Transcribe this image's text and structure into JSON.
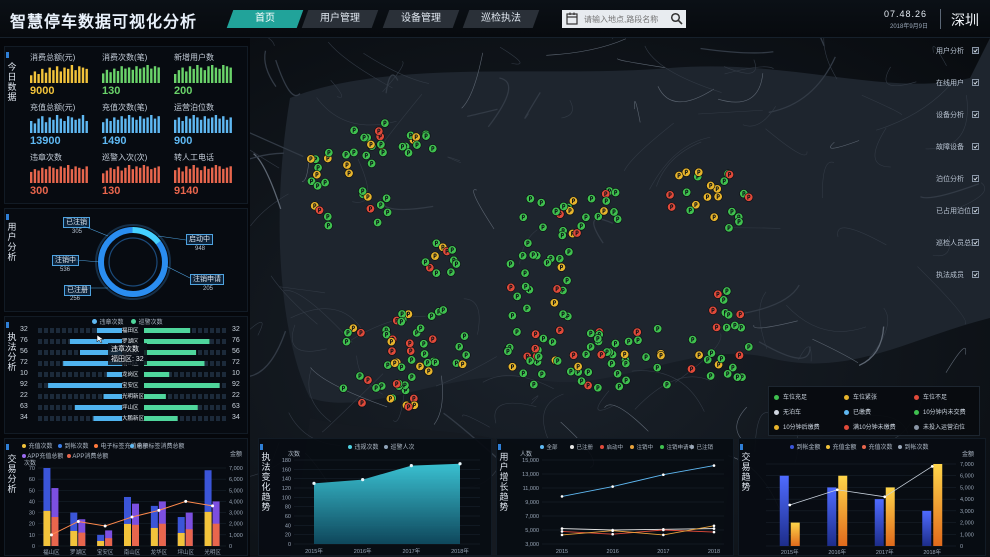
{
  "header": {
    "title": "智慧停车数据可视化分析",
    "nav": [
      "首页",
      "用户管理",
      "设备管理",
      "巡检执法"
    ],
    "search_placeholder": "请输入地点,路段名称",
    "time": "07.48.26",
    "date": "2018年9月9日",
    "city": "深圳"
  },
  "today": {
    "side": "今日数据",
    "metrics": [
      {
        "label": "消费总额(元)",
        "value": "9000",
        "color": "#f2c33b",
        "spark": [
          6,
          9,
          7,
          11,
          8,
          12,
          10,
          13,
          9,
          12,
          11,
          14,
          10,
          13,
          12,
          11
        ]
      },
      {
        "label": "消费次数(笔)",
        "value": "130",
        "color": "#6ad36a",
        "spark": [
          8,
          11,
          9,
          12,
          10,
          14,
          12,
          13,
          11,
          14,
          12,
          13,
          15,
          12,
          14,
          13
        ]
      },
      {
        "label": "新增用户数",
        "value": "200",
        "color": "#6ad36a",
        "spark": [
          7,
          10,
          12,
          9,
          13,
          11,
          14,
          12,
          10,
          13,
          14,
          12,
          11,
          14,
          13,
          12
        ]
      },
      {
        "label": "充值总额(元)",
        "value": "13900",
        "color": "#5fb8f2",
        "spark": [
          10,
          8,
          12,
          14,
          9,
          13,
          11,
          15,
          12,
          10,
          14,
          13,
          11,
          12,
          15,
          10
        ]
      },
      {
        "label": "充值次数(笔)",
        "value": "1490",
        "color": "#5fb8f2",
        "spark": [
          9,
          12,
          10,
          13,
          11,
          14,
          12,
          15,
          13,
          11,
          14,
          12,
          13,
          15,
          12,
          14
        ]
      },
      {
        "label": "运营泊位数",
        "value": "900",
        "color": "#5fb8f2",
        "spark": [
          11,
          13,
          10,
          14,
          12,
          15,
          13,
          11,
          14,
          12,
          13,
          15,
          12,
          14,
          11,
          13
        ]
      },
      {
        "label": "违章次数",
        "value": "300",
        "color": "#e8664d",
        "spark": [
          8,
          10,
          9,
          11,
          10,
          12,
          11,
          10,
          12,
          11,
          13,
          10,
          12,
          11,
          10,
          12
        ]
      },
      {
        "label": "巡警入次(次)",
        "value": "130",
        "color": "#e8664d",
        "spark": [
          7,
          9,
          11,
          10,
          12,
          9,
          11,
          13,
          10,
          12,
          11,
          13,
          12,
          10,
          11,
          12
        ]
      },
      {
        "label": "转人工电话",
        "value": "9140",
        "color": "#e8664d",
        "spark": [
          10,
          12,
          9,
          13,
          11,
          14,
          12,
          10,
          13,
          11,
          12,
          14,
          13,
          11,
          12,
          13
        ]
      }
    ]
  },
  "users": {
    "side": "用户分析",
    "items": [
      {
        "label": "已注销",
        "value": "305"
      },
      {
        "label": "注销中",
        "value": "536"
      },
      {
        "label": "已注册",
        "value": "256"
      },
      {
        "label": "启动中",
        "value": "948"
      },
      {
        "label": "注销申请",
        "value": "205"
      }
    ]
  },
  "enforce": {
    "side": "执法分析",
    "legend": [
      "违章次数",
      "巡警次数"
    ],
    "rows": [
      {
        "left": "32",
        "name": "福田区",
        "right": "32",
        "a": 0.3,
        "b": 0.55
      },
      {
        "left": "76",
        "name": "罗湖区",
        "right": "76",
        "a": 0.62,
        "b": 0.78
      },
      {
        "left": "56",
        "name": "盐田区",
        "right": "56",
        "a": 0.5,
        "b": 0.62
      },
      {
        "left": "72",
        "name": "南山区",
        "right": "72",
        "a": 0.7,
        "b": 0.72
      },
      {
        "left": "10",
        "name": "龙岗区",
        "right": "10",
        "a": 0.18,
        "b": 0.3
      },
      {
        "left": "92",
        "name": "宝安区",
        "right": "92",
        "a": 0.88,
        "b": 0.9
      },
      {
        "left": "22",
        "name": "光明新区",
        "right": "22",
        "a": 0.22,
        "b": 0.26
      },
      {
        "left": "63",
        "name": "坪山区",
        "right": "63",
        "a": 0.56,
        "b": 0.64
      },
      {
        "left": "34",
        "name": "大鹏新区",
        "right": "34",
        "a": 0.34,
        "b": 0.4
      }
    ],
    "tooltip": {
      "line1": "违章次数",
      "line2": "福田区: 32"
    }
  },
  "right_menu": [
    "用户分析",
    "在线用户",
    "设备分析",
    "故障设备",
    "泊位分析",
    "已占用泊位",
    "巡检人员总数",
    "执法成员"
  ],
  "map_legend": [
    {
      "label": "车位充足",
      "color": "#3fc04f"
    },
    {
      "label": "车位紧张",
      "color": "#e7b42c"
    },
    {
      "label": "车位不足",
      "color": "#e04a3a"
    },
    {
      "label": "无泊车",
      "color": "#cfd6df"
    },
    {
      "label": "已缴费",
      "color": "#5fb8f2"
    },
    {
      "label": "10分钟内未交费",
      "color": "#3fc04f"
    },
    {
      "label": "10分钟后缴费",
      "color": "#e7b42c"
    },
    {
      "label": "满10分钟未缴费",
      "color": "#e04a3a"
    },
    {
      "label": "未投入运营泊位",
      "color": "#8a96a6"
    }
  ],
  "charts": {
    "trade": {
      "side": "交易分析",
      "legend": [
        "充值次数",
        "到帐次数",
        "电子标签充值总额",
        "电子标签消费总额",
        "APP充值总额",
        "APP消费总额"
      ],
      "ylabel_left": "次数",
      "ylabel_right": "金额"
    },
    "trend": {
      "side": "执法变化趋势",
      "legend": [
        "违规次数",
        "巡警人次"
      ],
      "ylabel": "次数"
    },
    "growth": {
      "side": "用户增长趋势",
      "legend": [
        "全部",
        "已注册",
        "启动中",
        "注销中",
        "注销申请中",
        "已注销"
      ],
      "ylabel": "人数"
    },
    "trade2": {
      "side": "交易趋势",
      "legend": [
        "到帐金额",
        "充值金额",
        "充值次数",
        "到帐次数"
      ],
      "ylabel": "金额"
    }
  },
  "chart_data": [
    {
      "type": "bar",
      "categories": [
        "福山区",
        "罗湖区",
        "宝安区",
        "南山区",
        "龙华区",
        "坪山区",
        "光明区"
      ],
      "series": [
        {
          "name": "充值次数",
          "values": [
            70,
            30,
            10,
            44,
            36,
            26,
            68
          ]
        },
        {
          "name": "到帐次数",
          "values": [
            52,
            24,
            14,
            38,
            40,
            30,
            40
          ]
        }
      ],
      "line": [
        10,
        22,
        18,
        26,
        32,
        40,
        36
      ],
      "ylim": [
        0,
        70
      ],
      "yticks_left": [
        "0",
        "10",
        "20",
        "30",
        "40",
        "50",
        "60",
        "70"
      ],
      "yticks_right": [
        "0",
        "1,000",
        "2,000",
        "3,000",
        "4,000",
        "5,000",
        "6,000",
        "7,000"
      ]
    },
    {
      "type": "area",
      "categories": [
        "2015年",
        "2016年",
        "2017年",
        "2018年"
      ],
      "series": [
        {
          "name": "违规次数",
          "values": [
            130,
            138,
            168,
            172
          ]
        }
      ],
      "ylim": [
        0,
        180
      ],
      "yticks": [
        "0",
        "20",
        "40",
        "60",
        "80",
        "100",
        "120",
        "140",
        "160",
        "180"
      ]
    },
    {
      "type": "line",
      "categories": [
        "2015",
        "2016",
        "2017",
        "2018"
      ],
      "series": [
        {
          "name": "全部",
          "values": [
            9800,
            11200,
            12900,
            14200
          ]
        },
        {
          "name": "已注册",
          "values": [
            5200,
            5000,
            5100,
            5200
          ]
        },
        {
          "name": "启动中",
          "values": [
            4800,
            4400,
            5000,
            4700
          ]
        },
        {
          "name": "注销中",
          "values": [
            4300,
            4900,
            4300,
            5600
          ]
        }
      ],
      "ylim": [
        3000,
        15000
      ],
      "yticks": [
        "3,000",
        "5,000",
        "7,000",
        "9,000",
        "11,000",
        "13,000",
        "15,000"
      ]
    },
    {
      "type": "bar",
      "categories": [
        "2015年",
        "2016年",
        "2017年",
        "2018年"
      ],
      "series": [
        {
          "name": "到帐金额",
          "values": [
            6000,
            5000,
            4000,
            3000
          ]
        },
        {
          "name": "充值金额",
          "values": [
            2000,
            6000,
            5000,
            7000
          ]
        }
      ],
      "line": [
        3500,
        4800,
        4200,
        6800
      ],
      "ylim": [
        0,
        7000
      ],
      "yticks": [
        "0",
        "1,000",
        "2,000",
        "3,000",
        "4,000",
        "5,000",
        "6,000",
        "7,000"
      ]
    }
  ]
}
